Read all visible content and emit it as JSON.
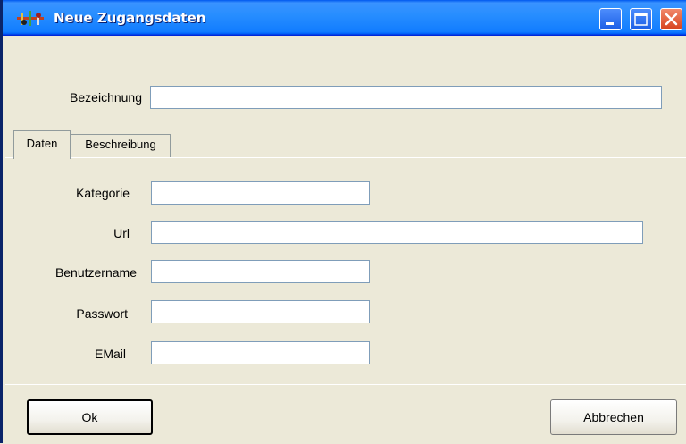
{
  "window": {
    "title": "Neue Zugangsdaten",
    "icon": "app-icon"
  },
  "form": {
    "bezeichnung": {
      "label": "Bezeichnung",
      "value": ""
    }
  },
  "tabs": [
    {
      "label": "Daten",
      "active": true
    },
    {
      "label": "Beschreibung",
      "active": false
    }
  ],
  "fields": {
    "kategorie": {
      "label": "Kategorie",
      "value": ""
    },
    "url": {
      "label": "Url",
      "value": ""
    },
    "benutzername": {
      "label": "Benutzername",
      "value": ""
    },
    "passwort": {
      "label": "Passwort",
      "value": ""
    },
    "email": {
      "label": "EMail",
      "value": ""
    }
  },
  "buttons": {
    "ok": "Ok",
    "cancel": "Abbrechen"
  },
  "colors": {
    "titlebar": "#0058ee",
    "background": "#ece9d8",
    "close_button": "#d7421c"
  }
}
